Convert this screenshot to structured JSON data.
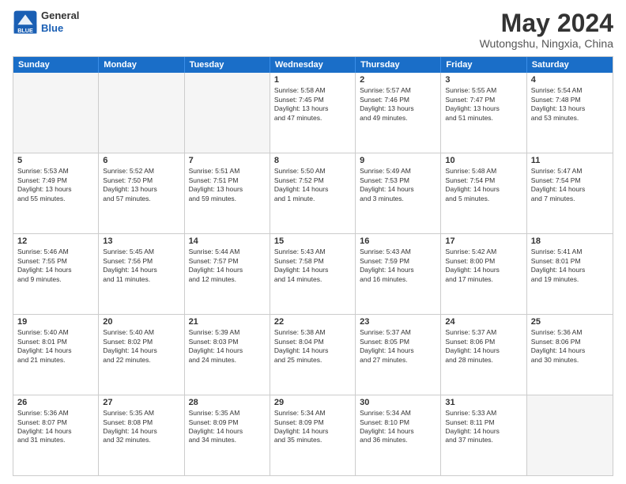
{
  "header": {
    "logo": {
      "general": "General",
      "blue": "Blue"
    },
    "title": "May 2024",
    "location": "Wutongshu, Ningxia, China"
  },
  "weekdays": [
    "Sunday",
    "Monday",
    "Tuesday",
    "Wednesday",
    "Thursday",
    "Friday",
    "Saturday"
  ],
  "rows": [
    [
      {
        "day": "",
        "text": "",
        "empty": true
      },
      {
        "day": "",
        "text": "",
        "empty": true
      },
      {
        "day": "",
        "text": "",
        "empty": true
      },
      {
        "day": "1",
        "text": "Sunrise: 5:58 AM\nSunset: 7:45 PM\nDaylight: 13 hours\nand 47 minutes."
      },
      {
        "day": "2",
        "text": "Sunrise: 5:57 AM\nSunset: 7:46 PM\nDaylight: 13 hours\nand 49 minutes."
      },
      {
        "day": "3",
        "text": "Sunrise: 5:55 AM\nSunset: 7:47 PM\nDaylight: 13 hours\nand 51 minutes."
      },
      {
        "day": "4",
        "text": "Sunrise: 5:54 AM\nSunset: 7:48 PM\nDaylight: 13 hours\nand 53 minutes."
      }
    ],
    [
      {
        "day": "5",
        "text": "Sunrise: 5:53 AM\nSunset: 7:49 PM\nDaylight: 13 hours\nand 55 minutes."
      },
      {
        "day": "6",
        "text": "Sunrise: 5:52 AM\nSunset: 7:50 PM\nDaylight: 13 hours\nand 57 minutes."
      },
      {
        "day": "7",
        "text": "Sunrise: 5:51 AM\nSunset: 7:51 PM\nDaylight: 13 hours\nand 59 minutes."
      },
      {
        "day": "8",
        "text": "Sunrise: 5:50 AM\nSunset: 7:52 PM\nDaylight: 14 hours\nand 1 minute."
      },
      {
        "day": "9",
        "text": "Sunrise: 5:49 AM\nSunset: 7:53 PM\nDaylight: 14 hours\nand 3 minutes."
      },
      {
        "day": "10",
        "text": "Sunrise: 5:48 AM\nSunset: 7:54 PM\nDaylight: 14 hours\nand 5 minutes."
      },
      {
        "day": "11",
        "text": "Sunrise: 5:47 AM\nSunset: 7:54 PM\nDaylight: 14 hours\nand 7 minutes."
      }
    ],
    [
      {
        "day": "12",
        "text": "Sunrise: 5:46 AM\nSunset: 7:55 PM\nDaylight: 14 hours\nand 9 minutes."
      },
      {
        "day": "13",
        "text": "Sunrise: 5:45 AM\nSunset: 7:56 PM\nDaylight: 14 hours\nand 11 minutes."
      },
      {
        "day": "14",
        "text": "Sunrise: 5:44 AM\nSunset: 7:57 PM\nDaylight: 14 hours\nand 12 minutes."
      },
      {
        "day": "15",
        "text": "Sunrise: 5:43 AM\nSunset: 7:58 PM\nDaylight: 14 hours\nand 14 minutes."
      },
      {
        "day": "16",
        "text": "Sunrise: 5:43 AM\nSunset: 7:59 PM\nDaylight: 14 hours\nand 16 minutes."
      },
      {
        "day": "17",
        "text": "Sunrise: 5:42 AM\nSunset: 8:00 PM\nDaylight: 14 hours\nand 17 minutes."
      },
      {
        "day": "18",
        "text": "Sunrise: 5:41 AM\nSunset: 8:01 PM\nDaylight: 14 hours\nand 19 minutes."
      }
    ],
    [
      {
        "day": "19",
        "text": "Sunrise: 5:40 AM\nSunset: 8:01 PM\nDaylight: 14 hours\nand 21 minutes."
      },
      {
        "day": "20",
        "text": "Sunrise: 5:40 AM\nSunset: 8:02 PM\nDaylight: 14 hours\nand 22 minutes."
      },
      {
        "day": "21",
        "text": "Sunrise: 5:39 AM\nSunset: 8:03 PM\nDaylight: 14 hours\nand 24 minutes."
      },
      {
        "day": "22",
        "text": "Sunrise: 5:38 AM\nSunset: 8:04 PM\nDaylight: 14 hours\nand 25 minutes."
      },
      {
        "day": "23",
        "text": "Sunrise: 5:37 AM\nSunset: 8:05 PM\nDaylight: 14 hours\nand 27 minutes."
      },
      {
        "day": "24",
        "text": "Sunrise: 5:37 AM\nSunset: 8:06 PM\nDaylight: 14 hours\nand 28 minutes."
      },
      {
        "day": "25",
        "text": "Sunrise: 5:36 AM\nSunset: 8:06 PM\nDaylight: 14 hours\nand 30 minutes."
      }
    ],
    [
      {
        "day": "26",
        "text": "Sunrise: 5:36 AM\nSunset: 8:07 PM\nDaylight: 14 hours\nand 31 minutes."
      },
      {
        "day": "27",
        "text": "Sunrise: 5:35 AM\nSunset: 8:08 PM\nDaylight: 14 hours\nand 32 minutes."
      },
      {
        "day": "28",
        "text": "Sunrise: 5:35 AM\nSunset: 8:09 PM\nDaylight: 14 hours\nand 34 minutes."
      },
      {
        "day": "29",
        "text": "Sunrise: 5:34 AM\nSunset: 8:09 PM\nDaylight: 14 hours\nand 35 minutes."
      },
      {
        "day": "30",
        "text": "Sunrise: 5:34 AM\nSunset: 8:10 PM\nDaylight: 14 hours\nand 36 minutes."
      },
      {
        "day": "31",
        "text": "Sunrise: 5:33 AM\nSunset: 8:11 PM\nDaylight: 14 hours\nand 37 minutes."
      },
      {
        "day": "",
        "text": "",
        "empty": true
      }
    ]
  ]
}
